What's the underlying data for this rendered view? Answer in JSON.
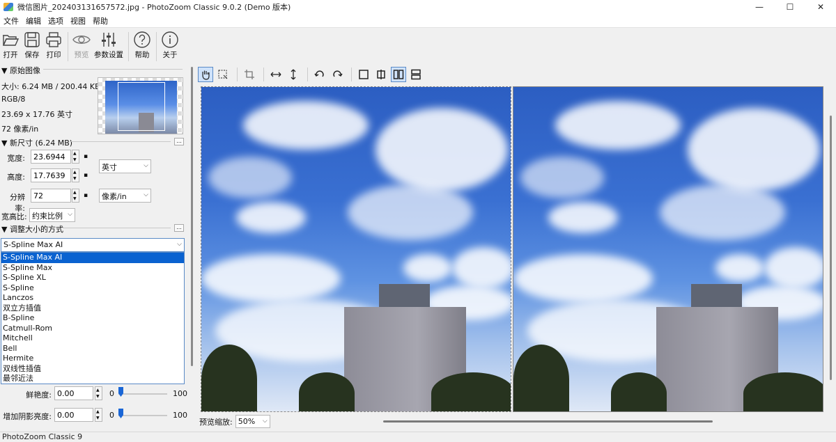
{
  "window": {
    "title": "微信图片_202403131657572.jpg - PhotoZoom Classic 9.0.2 (Demo 版本)",
    "minimize": "—",
    "maximize": "☐",
    "close": "✕"
  },
  "menu": [
    "文件",
    "编辑",
    "选项",
    "视图",
    "帮助"
  ],
  "toolbar": {
    "open": "打开",
    "save": "保存",
    "print": "打印",
    "preview": "预览",
    "params": "参数设置",
    "help": "帮助",
    "about": "关于"
  },
  "original": {
    "header": "▼ 原始图像",
    "size": "大小: 6.24 MB / 200.44 KB",
    "mode": "RGB/8",
    "dimensions": "23.69 x 17.76 英寸",
    "resolution": "72 像素/in"
  },
  "newsize": {
    "header": "▼ 新尺寸 (6.24 MB)",
    "more": "...",
    "width_label": "宽度:",
    "width_value": "23.6944",
    "height_label": "高度:",
    "height_value": "17.7639",
    "res_label": "分辨率:",
    "res_value": "72",
    "unit": "英寸",
    "res_unit": "像素/in",
    "aspect_label": "宽高比:",
    "aspect_value": "约束比例"
  },
  "resize": {
    "header": "▼ 调整大小的方式",
    "more": "...",
    "selected": "S-Spline Max AI",
    "options": [
      "S-Spline Max AI",
      "S-Spline Max",
      "S-Spline XL",
      "S-Spline",
      "Lanczos",
      "双立方插值",
      "B-Spline",
      "Catmull-Rom",
      "Mitchell",
      "Bell",
      "Hermite",
      "双线性插值",
      "最邻近法"
    ]
  },
  "sliders": [
    {
      "label": "鲜艳度:",
      "value": "0.00",
      "min": "0",
      "max": "100",
      "level": 0
    },
    {
      "label": "增加阴影亮度:",
      "value": "0.00",
      "min": "0",
      "max": "100",
      "level": 0
    }
  ],
  "preview": {
    "zoom_label": "预览缩放:",
    "zoom_value": "50%"
  },
  "status": "PhotoZoom Classic 9"
}
